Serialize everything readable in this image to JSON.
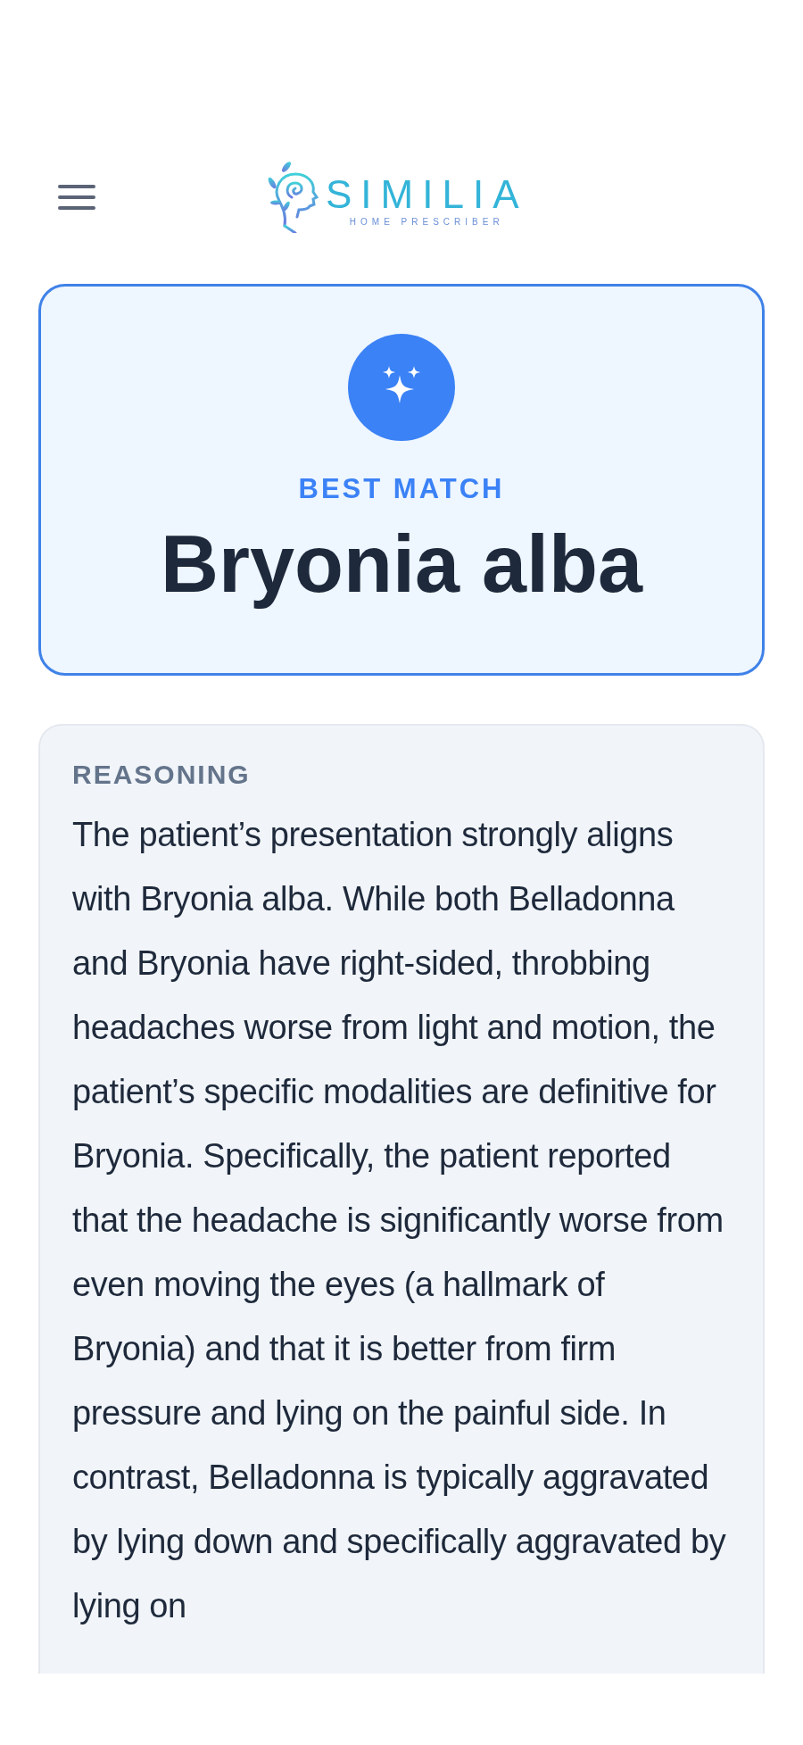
{
  "header": {
    "logo_title": "SIMILIA",
    "logo_subtitle": "HOME PRESCRIBER"
  },
  "best_match": {
    "label": "BEST MATCH",
    "remedy": "Bryonia alba"
  },
  "reasoning": {
    "label": "REASONING",
    "text": "The patient’s presentation strongly aligns with Bryonia alba. While both Belladonna and Bryonia have right-sided, throbbing headaches worse from light and motion, the patient’s specific modalities are definitive for Bryonia. Specifically, the patient reported that the headache is significantly worse from even moving the eyes (a hallmark of Bryonia) and that it is better from firm pressure and lying on the painful side. In contrast, Belladonna is typically aggravated by lying down and specifically aggravated by lying on"
  }
}
